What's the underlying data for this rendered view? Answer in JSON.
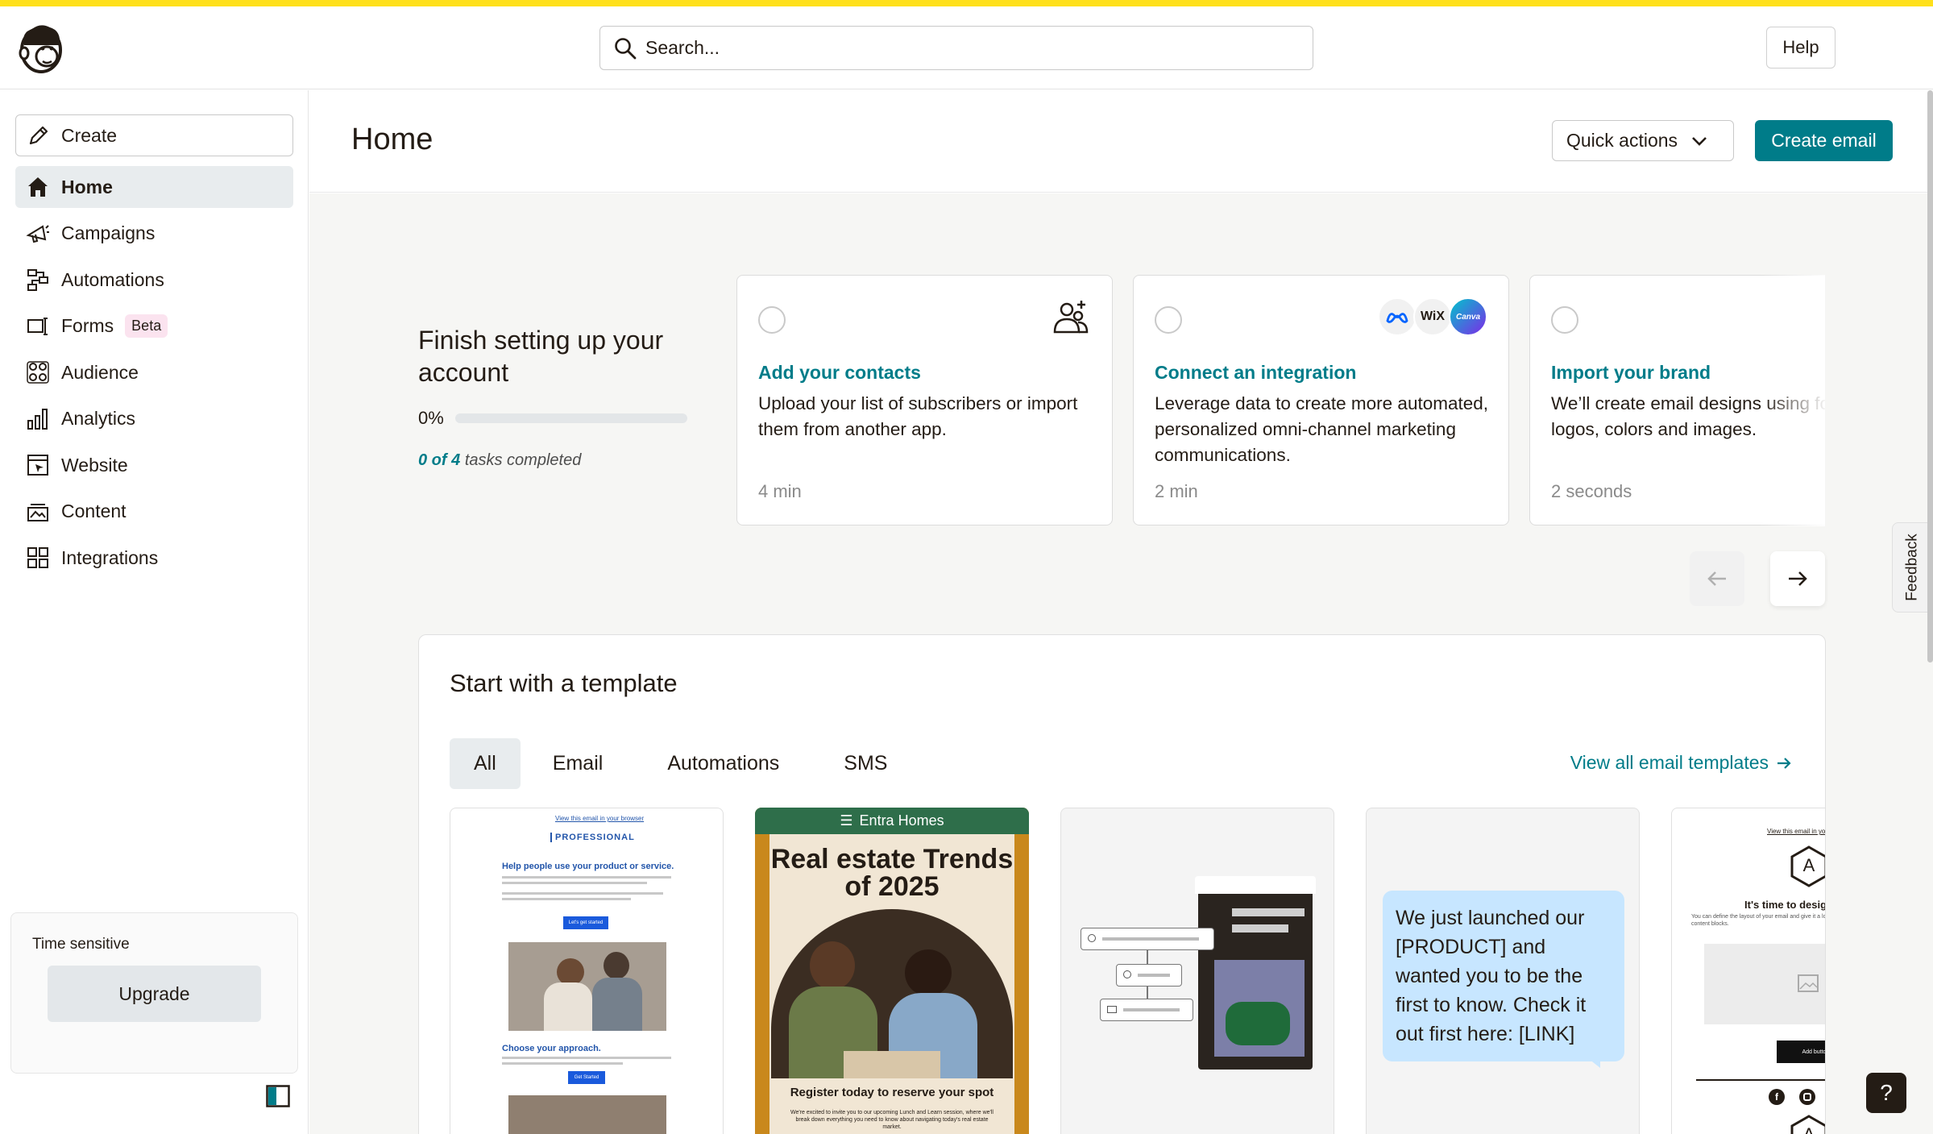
{
  "header": {
    "search_placeholder": "Search...",
    "help_label": "Help"
  },
  "sidebar": {
    "create_label": "Create",
    "items": [
      {
        "label": "Home",
        "active": true
      },
      {
        "label": "Campaigns"
      },
      {
        "label": "Automations"
      },
      {
        "label": "Forms",
        "badge": "Beta"
      },
      {
        "label": "Audience"
      },
      {
        "label": "Analytics"
      },
      {
        "label": "Website"
      },
      {
        "label": "Content"
      },
      {
        "label": "Integrations"
      }
    ],
    "time_sensitive": {
      "label": "Time sensitive",
      "upgrade_label": "Upgrade"
    }
  },
  "main": {
    "title": "Home",
    "quick_actions_label": "Quick actions",
    "create_email_label": "Create email"
  },
  "setup": {
    "title": "Finish setting up your account",
    "progress_pct": "0%",
    "progress_value": 0,
    "tasks_count": "0 of 4",
    "tasks_suffix": "tasks completed",
    "cards": [
      {
        "title": "Add your contacts",
        "description": "Upload your list of subscribers or import them from another app.",
        "time": "4 min"
      },
      {
        "title": "Connect an integration",
        "description": "Leverage data to create more automated, personalized omni-channel marketing communications.",
        "time": "2 min",
        "icons": [
          "meta-icon",
          "wix-icon",
          "canva-icon"
        ],
        "wix_text": "WiX",
        "canva_text": "Canva"
      },
      {
        "title": "Import your brand",
        "description": "We’ll create email designs using fonts, logos, colors and images.",
        "time": "2 seconds"
      }
    ]
  },
  "templates": {
    "title": "Start with a template",
    "tabs": [
      "All",
      "Email",
      "Automations",
      "SMS"
    ],
    "view_all_label": "View all email templates",
    "cards": {
      "professional": {
        "browser_link": "View this email in your browser",
        "brand": "PROFESSIONAL",
        "heading": "Help people use your product or service.",
        "cta": "Let's get started",
        "subheading": "Choose your approach.",
        "cta2": "Get Started"
      },
      "realestate": {
        "brand": "Entra Homes",
        "title": "Real estate Trends of 2025",
        "footer": "Register today to reserve your spot",
        "body": "We're excited to invite you to our upcoming Lunch and Learn session, where we'll break down everything you need to know about navigating today's real estate market."
      },
      "sms": {
        "message": "We just launched our [PRODUCT] and wanted you to be the first to know. Check it out first here: [LINK]"
      },
      "design": {
        "browser_link": "View this email in your browser",
        "heading": "It's time to design",
        "body": "You can define the layout of your email and give it a look by adding, rearranging, and deleting content blocks.",
        "button": "Add button text",
        "logo_letter": "A"
      }
    }
  },
  "feedback_label": "Feedback",
  "help_fab_label": "?",
  "colors": {
    "accent": "#007c89",
    "topbar": "#ffe01b",
    "badge_bg": "#fbe3ef"
  }
}
